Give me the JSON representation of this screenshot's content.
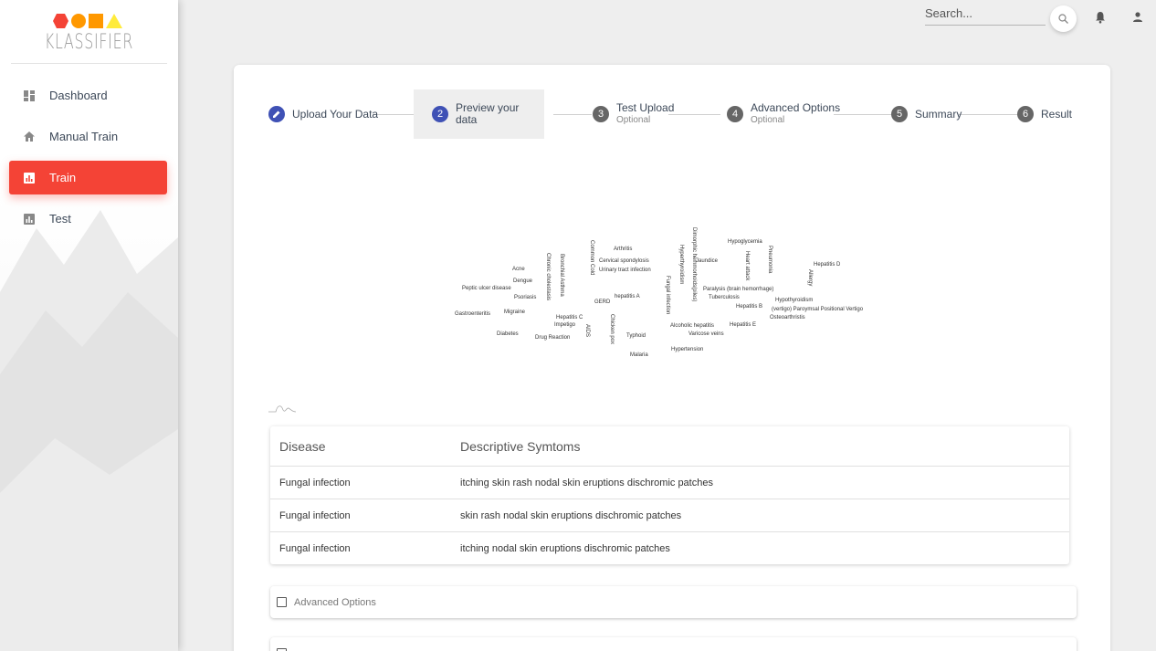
{
  "brand": {
    "name": "KLASSIFIER",
    "colors": {
      "hexagon": "#f44336",
      "circle": "#ff9800",
      "square": "#ff9800",
      "triangle": "#ffeb3b"
    }
  },
  "sidebar": {
    "items": [
      {
        "label": "Dashboard",
        "icon": "dashboard-icon",
        "active": false
      },
      {
        "label": "Manual Train",
        "icon": "home-icon",
        "active": false
      },
      {
        "label": "Train",
        "icon": "bar-chart-icon",
        "active": true
      },
      {
        "label": "Test",
        "icon": "bar-chart-icon",
        "active": false
      }
    ],
    "accent": "#f44336"
  },
  "topbar": {
    "search_placeholder": "Search..."
  },
  "stepper": {
    "steps": [
      {
        "num": "1",
        "label": "Upload Your Data",
        "optional": "",
        "state": "done"
      },
      {
        "num": "2",
        "label": "Preview your data",
        "optional": "",
        "state": "active"
      },
      {
        "num": "3",
        "label": "Test Upload",
        "optional": "Optional",
        "state": "todo"
      },
      {
        "num": "4",
        "label": "Advanced Options",
        "optional": "Optional",
        "state": "todo"
      },
      {
        "num": "5",
        "label": "Summary",
        "optional": "",
        "state": "todo"
      },
      {
        "num": "6",
        "label": "Result",
        "optional": "",
        "state": "todo"
      }
    ]
  },
  "wordcloud": {
    "words": [
      "Arthritis",
      "Cervical spondylosis",
      "Urinary tract infection",
      "Common Cold",
      "Bronchial Asthma",
      "Chronic cholestasis",
      "Acne",
      "Dengue",
      "Peptic ulcer disease",
      "Psoriasis",
      "GERD",
      "hepatitis A",
      "Fungal infection",
      "Gastroenteritis",
      "Migraine",
      "Hepatitis C",
      "Impetigo",
      "AIDS",
      "Chicken pox",
      "Diabetes",
      "Drug Reaction",
      "Typhoid",
      "Malaria",
      "Dimorphic hemmorhoids(piles)",
      "Hyperthyroidism",
      "Jaundice",
      "Hypoglycemia",
      "Heart attack",
      "Pneumonia",
      "Hepatitis D",
      "Allergy",
      "Paralysis (brain hemorrhage)",
      "Tuberculosis",
      "Hepatitis B",
      "Hypothyroidism",
      "(vertigo) Paroymsal Positional Vertigo",
      "Osteoarthristis",
      "Alcoholic hepatitis",
      "Hepatitis E",
      "Varicose veins",
      "Hypertension"
    ]
  },
  "table": {
    "headers": [
      "Disease",
      "Descriptive Symtoms"
    ],
    "rows": [
      [
        "Fungal infection",
        "itching skin rash nodal skin eruptions dischromic patches"
      ],
      [
        "Fungal infection",
        "skin rash nodal skin eruptions dischromic patches"
      ],
      [
        "Fungal infection",
        "itching nodal skin eruptions dischromic patches"
      ]
    ]
  },
  "panels": {
    "advanced_label": "Advanced Options"
  }
}
